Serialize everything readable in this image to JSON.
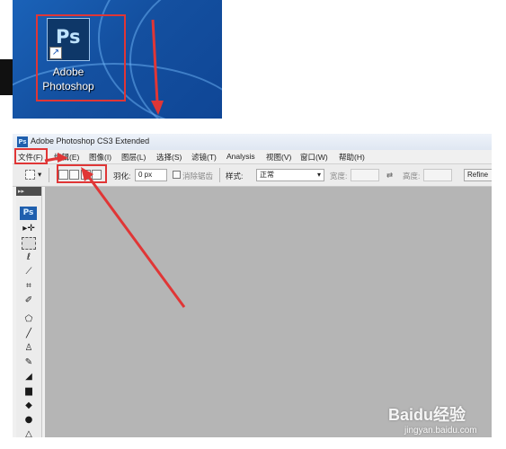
{
  "desktop": {
    "icon_badge": "Ps",
    "icon_label_line1": "Adobe",
    "icon_label_line2": "Photoshop"
  },
  "window": {
    "title": "Adobe Photoshop CS3 Extended",
    "icon": "Ps"
  },
  "menubar": {
    "items": [
      "文件(F)",
      "编辑(E)",
      "图像(I)",
      "图层(L)",
      "选择(S)",
      "滤镜(T)",
      "Analysis",
      "视图(V)",
      "窗口(W)",
      "帮助(H)"
    ]
  },
  "options_bar": {
    "feather_label": "羽化:",
    "feather_value": "0 px",
    "antialias_label": "消除锯齿",
    "style_label": "样式:",
    "style_value": "正常",
    "width_label": "宽度:",
    "height_label": "高度:",
    "refine_label": "Refine"
  },
  "toolbox": {
    "grip": "▸▸",
    "logo": "Ps",
    "tools": [
      "move-tool",
      "marquee-tool",
      "lasso-tool",
      "magic-wand-tool",
      "crop-tool",
      "slice-tool",
      "healing-brush-tool",
      "brush-tool",
      "clone-stamp-tool",
      "history-brush-tool",
      "eraser-tool",
      "gradient-tool",
      "blur-tool",
      "dodge-tool",
      "pen-tool"
    ]
  },
  "annotation_color": "#e03636",
  "watermark": {
    "logo": "Baidu经验",
    "url": "jingyan.baidu.com"
  }
}
